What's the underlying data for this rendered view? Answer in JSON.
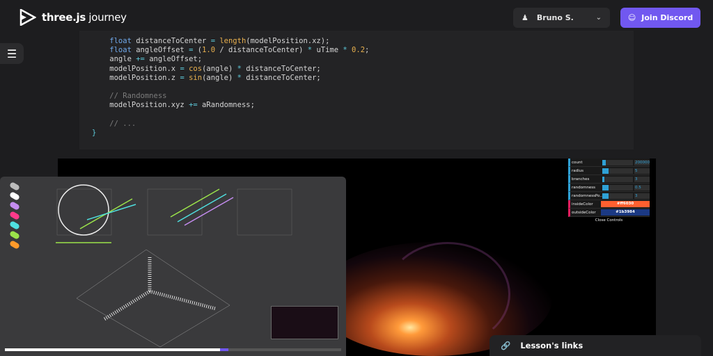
{
  "header": {
    "logo_bold": "three.js",
    "logo_light": " journey",
    "user_name": "Bruno S.",
    "discord_label": "Join Discord"
  },
  "code": {
    "lines": [
      [
        {
          "t": "    float ",
          "c": "k"
        },
        {
          "t": "distanceToCenter ",
          "c": ""
        },
        {
          "t": "=",
          "c": "o"
        },
        {
          "t": " ",
          "c": ""
        },
        {
          "t": "length",
          "c": "f"
        },
        {
          "t": "(modelPosition.xz);",
          "c": ""
        }
      ],
      [
        {
          "t": "    float ",
          "c": "k"
        },
        {
          "t": "angleOffset ",
          "c": ""
        },
        {
          "t": "=",
          "c": "o"
        },
        {
          "t": " (",
          "c": ""
        },
        {
          "t": "1.0",
          "c": "n"
        },
        {
          "t": " / distanceToCenter) ",
          "c": ""
        },
        {
          "t": "*",
          "c": "o"
        },
        {
          "t": " uTime ",
          "c": ""
        },
        {
          "t": "*",
          "c": "o"
        },
        {
          "t": " ",
          "c": ""
        },
        {
          "t": "0.2",
          "c": "n"
        },
        {
          "t": ";",
          "c": ""
        }
      ],
      [
        {
          "t": "    angle ",
          "c": ""
        },
        {
          "t": "+=",
          "c": "o"
        },
        {
          "t": " angleOffset;",
          "c": ""
        }
      ],
      [
        {
          "t": "    modelPosition.x ",
          "c": ""
        },
        {
          "t": "=",
          "c": "o"
        },
        {
          "t": " ",
          "c": ""
        },
        {
          "t": "cos",
          "c": "f"
        },
        {
          "t": "(angle) ",
          "c": ""
        },
        {
          "t": "*",
          "c": "o"
        },
        {
          "t": " distanceToCenter;",
          "c": ""
        }
      ],
      [
        {
          "t": "    modelPosition.z ",
          "c": ""
        },
        {
          "t": "=",
          "c": "o"
        },
        {
          "t": " ",
          "c": ""
        },
        {
          "t": "sin",
          "c": "f"
        },
        {
          "t": "(angle) ",
          "c": ""
        },
        {
          "t": "*",
          "c": "o"
        },
        {
          "t": " distanceToCenter;",
          "c": ""
        }
      ],
      [
        {
          "t": "",
          "c": ""
        }
      ],
      [
        {
          "t": "    // Randomness",
          "c": "c"
        }
      ],
      [
        {
          "t": "    modelPosition.xyz ",
          "c": ""
        },
        {
          "t": "+=",
          "c": "o"
        },
        {
          "t": " aRandomness;",
          "c": ""
        }
      ],
      [
        {
          "t": "",
          "c": ""
        }
      ],
      [
        {
          "t": "    // ...",
          "c": "c"
        }
      ],
      [
        {
          "t": "}",
          "c": "o"
        }
      ]
    ]
  },
  "gui": {
    "rows": [
      {
        "label": "count",
        "value": "200000",
        "fill": 0.12
      },
      {
        "label": "radius",
        "value": "5",
        "fill": 0.2
      },
      {
        "label": "branches",
        "value": "3",
        "fill": 0.03
      },
      {
        "label": "randomness",
        "value": "0.5",
        "fill": 0.2
      },
      {
        "label": "randomnessPo...",
        "value": "3",
        "fill": 0.2
      }
    ],
    "colors": [
      {
        "label": "insideColor",
        "value": "#ff6030"
      },
      {
        "label": "outsideColor",
        "value": "#1b3984"
      }
    ],
    "close_label": "Close Controls"
  },
  "board": {
    "palette": [
      "#bbbbbb",
      "#ffffff",
      "#c58cf0",
      "#ff3a8a",
      "#4fe0e0",
      "#9be34a",
      "#ff9a2a"
    ]
  },
  "video": {
    "progress": 0.64,
    "buffered": 0.665
  },
  "links": {
    "label": "Lesson's links"
  }
}
